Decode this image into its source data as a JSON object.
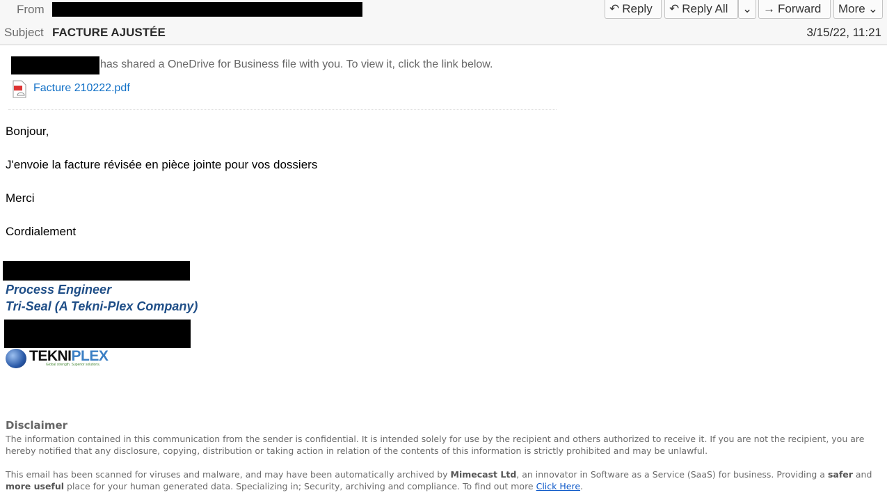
{
  "header": {
    "from_label": "From",
    "subject_label": "Subject",
    "subject": "FACTURE AJUSTÉE",
    "date": "3/15/22, 11:21",
    "buttons": {
      "reply": "Reply",
      "reply_all": "Reply All",
      "forward": "Forward",
      "more": "More"
    }
  },
  "share": {
    "text": "has shared a OneDrive for Business file with you. To view it, click the link below.",
    "file_name": "Facture 210222.pdf"
  },
  "body": {
    "greeting": "Bonjour,",
    "line1": "J'envoie la facture révisée en pièce jointe pour vos dossiers",
    "thanks": "Merci",
    "closing": "Cordialement"
  },
  "signature": {
    "title": "Process Engineer",
    "company": "Tri-Seal (A Tekni-Plex Company)",
    "logo_text": "TEKNIPLEX",
    "logo_tagline": "Global strength. Superior solutions."
  },
  "disclaimer": {
    "heading": "Disclaimer",
    "para1": "The information contained in this communication from the sender is confidential. It is intended solely for use by the recipient and others authorized to receive it. If you are not the recipient, you are hereby notified that any disclosure, copying, distribution or taking action in relation of the contents of this information is strictly prohibited and may be unlawful.",
    "p2a": "This email has been scanned for viruses and malware, and may have been automatically archived by ",
    "p2b": "Mimecast Ltd",
    "p2c": ", an innovator in Software as a Service (SaaS) for business. Providing a ",
    "p2d": "safer",
    "p2e": " and ",
    "p2f": "more useful",
    "p2g": " place for your human generated data. Specializing in; Security, archiving and compliance. To find out more ",
    "link": "Click Here",
    "p2h": "."
  }
}
